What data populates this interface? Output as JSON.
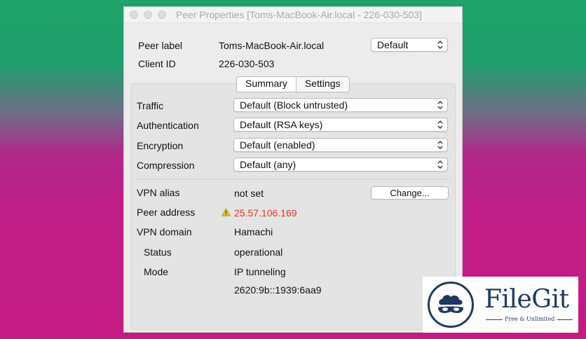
{
  "window": {
    "title": "Peer Properties [Toms-MacBook-Air.local - 226-030-503]"
  },
  "header": {
    "peer_label_label": "Peer label",
    "peer_label_value": "Toms-MacBook-Air.local",
    "peer_label_option": "Default",
    "client_id_label": "Client ID",
    "client_id_value": "226-030-503"
  },
  "tabs": [
    {
      "label": "Summary",
      "selected": true
    },
    {
      "label": "Settings",
      "selected": false
    }
  ],
  "settings": [
    {
      "label": "Traffic",
      "value": "Default (Block untrusted)"
    },
    {
      "label": "Authentication",
      "value": "Default (RSA keys)"
    },
    {
      "label": "Encryption",
      "value": "Default (enabled)"
    },
    {
      "label": "Compression",
      "value": "Default (any)"
    }
  ],
  "info": {
    "vpn_alias_label": "VPN alias",
    "vpn_alias_value": "not set",
    "change_button": "Change...",
    "peer_address_label": "Peer address",
    "peer_address_value": "25.57.106.169",
    "vpn_domain_label": "VPN domain",
    "vpn_domain_value": "Hamachi",
    "status_label": "Status",
    "status_value": "operational",
    "mode_label": "Mode",
    "mode_value": "IP tunneling",
    "ipv6_value": "2620:9b::1939:6aa9"
  },
  "colors": {
    "warning_address": "#e8341e",
    "logo_navy": "#1e3a62"
  },
  "watermark": {
    "brand": "FileGit",
    "tagline": "Free & Unlimited",
    "icon": "cloud-mask-icon"
  }
}
